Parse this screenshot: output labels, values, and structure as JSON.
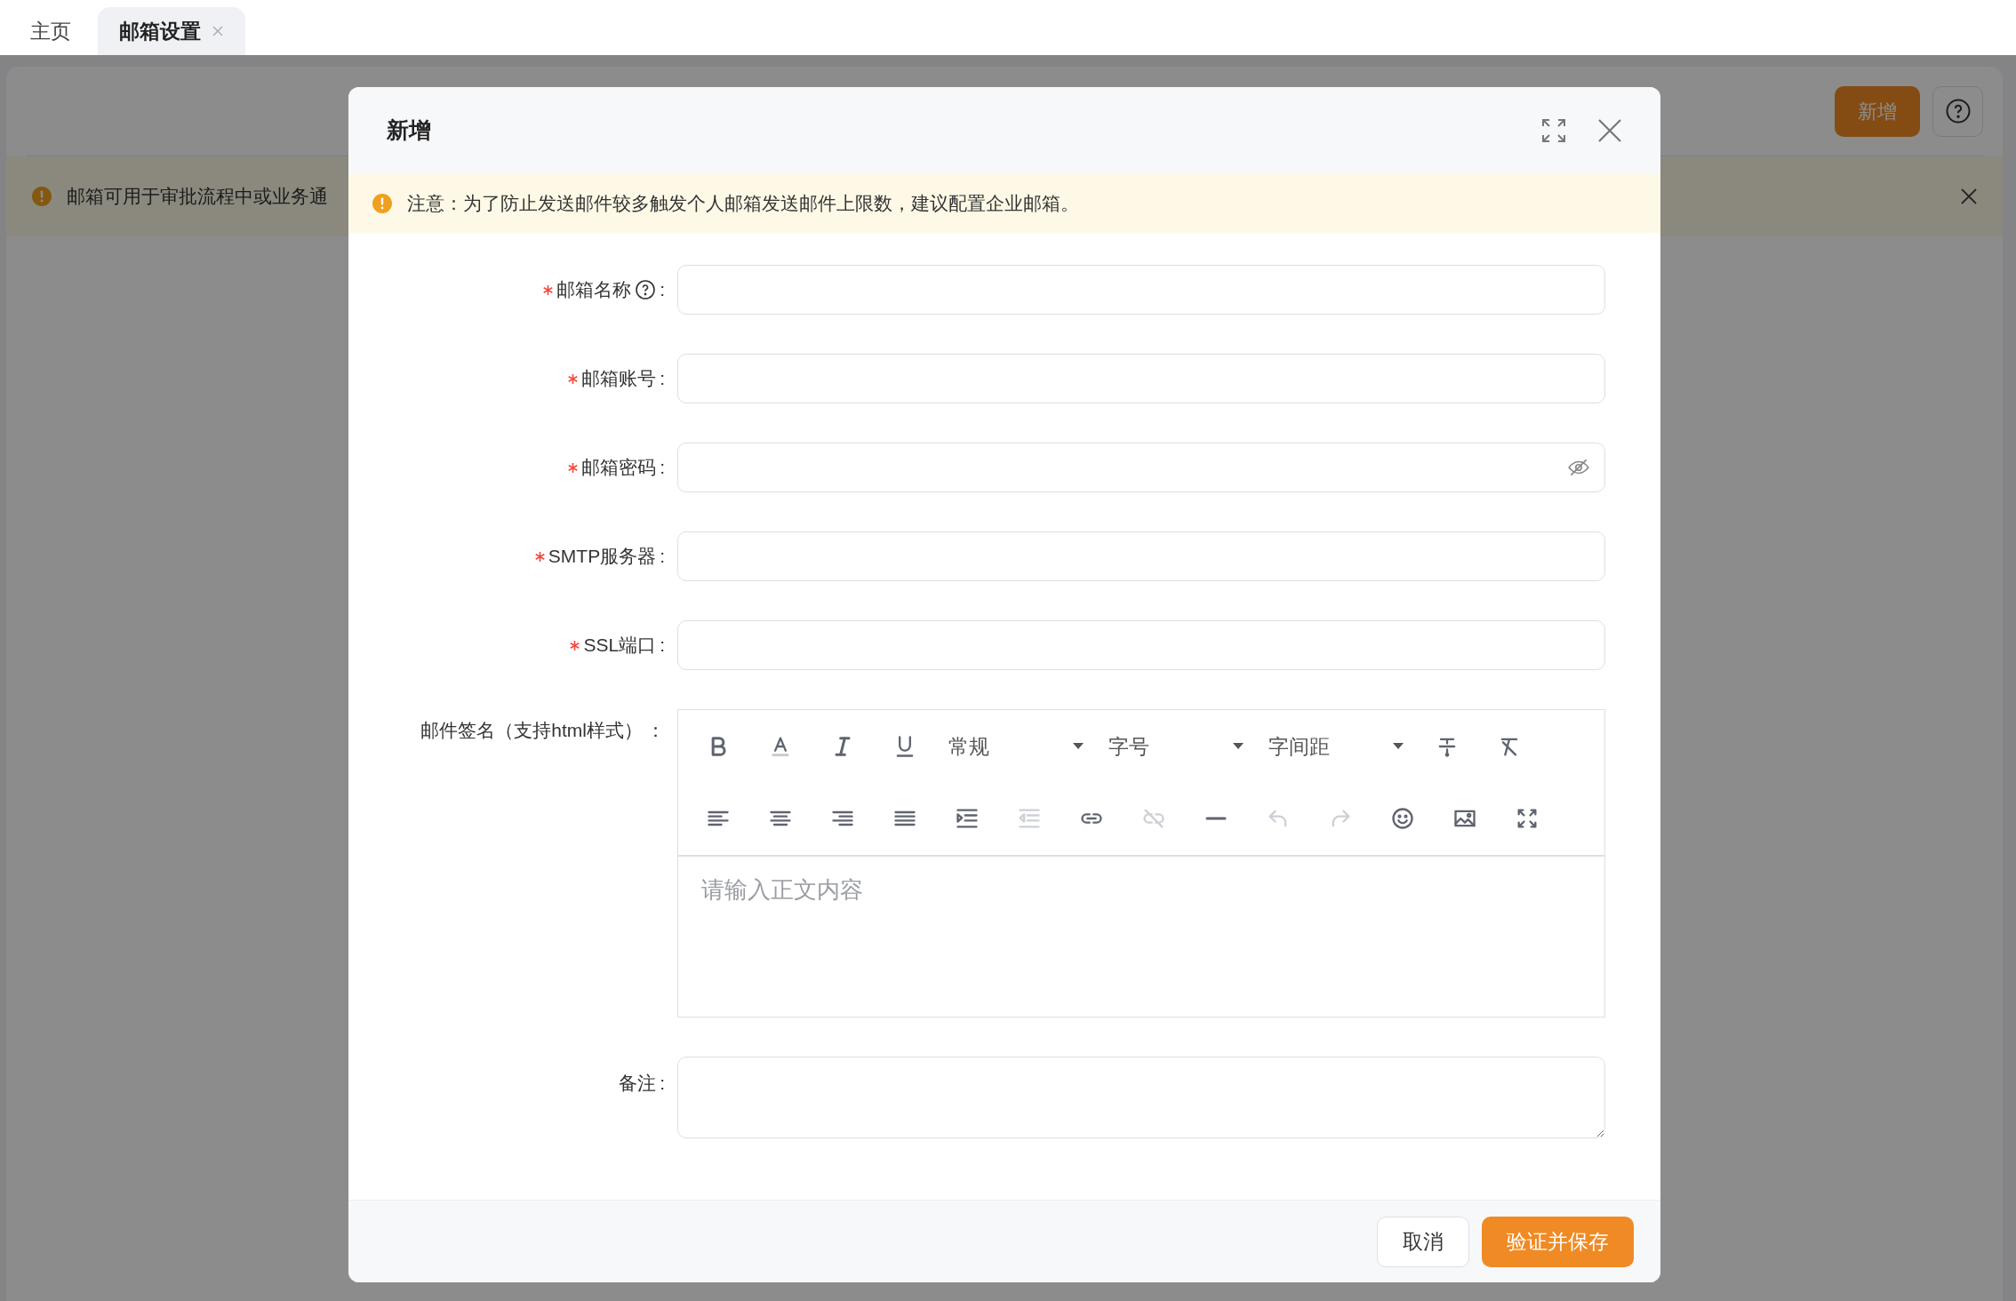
{
  "tabs": [
    {
      "label": "主页",
      "selected": false,
      "closable": false
    },
    {
      "label": "邮箱设置",
      "selected": true,
      "closable": true
    }
  ],
  "page": {
    "add_button": "新增",
    "notice": "邮箱可用于审批流程中或业务通"
  },
  "dialog": {
    "title": "新增",
    "notice": "注意：为了防止发送邮件较多触发个人邮箱发送邮件上限数，建议配置企业邮箱。",
    "fields": [
      {
        "label": "邮箱名称",
        "suffix": ":",
        "required": true,
        "help": true,
        "kind": "text"
      },
      {
        "label": "邮箱账号",
        "suffix": ":",
        "required": true,
        "help": false,
        "kind": "text"
      },
      {
        "label": "邮箱密码",
        "suffix": ":",
        "required": true,
        "help": false,
        "kind": "password"
      },
      {
        "label": "SMTP服务器",
        "suffix": ":",
        "required": true,
        "help": false,
        "kind": "text"
      },
      {
        "label": "SSL端口",
        "suffix": ":",
        "required": true,
        "help": false,
        "kind": "text"
      },
      {
        "label": "邮件签名（支持html样式）",
        "suffix": "：",
        "required": false,
        "help": false,
        "kind": "editor",
        "placeholder": "请输入正文内容"
      },
      {
        "label": "备注",
        "suffix": ":",
        "required": false,
        "help": false,
        "kind": "textarea"
      }
    ],
    "toolbar": [
      [
        {
          "kind": "button",
          "disabled": false
        },
        {
          "kind": "button",
          "disabled": false
        },
        {
          "kind": "button",
          "disabled": false
        },
        {
          "kind": "button",
          "disabled": false
        },
        {
          "kind": "select",
          "label": "常规"
        },
        {
          "kind": "select",
          "label": "字号"
        },
        {
          "kind": "select",
          "label": "字间距"
        },
        {
          "kind": "button",
          "disabled": false
        },
        {
          "kind": "button",
          "disabled": false
        }
      ],
      [
        {
          "kind": "button",
          "disabled": false
        },
        {
          "kind": "button",
          "disabled": false
        },
        {
          "kind": "button",
          "disabled": false
        },
        {
          "kind": "button",
          "disabled": false
        },
        {
          "kind": "button",
          "disabled": false
        },
        {
          "kind": "button",
          "disabled": true
        },
        {
          "kind": "button",
          "disabled": false
        },
        {
          "kind": "button",
          "disabled": true
        },
        {
          "kind": "button",
          "disabled": false
        },
        {
          "kind": "button",
          "disabled": true
        },
        {
          "kind": "button",
          "disabled": true
        },
        {
          "kind": "button",
          "disabled": false
        },
        {
          "kind": "button",
          "disabled": false
        },
        {
          "kind": "button",
          "disabled": false
        }
      ]
    ],
    "buttons": [
      {
        "label": "取消",
        "primary": false
      },
      {
        "label": "验证并保存",
        "primary": true
      }
    ]
  }
}
